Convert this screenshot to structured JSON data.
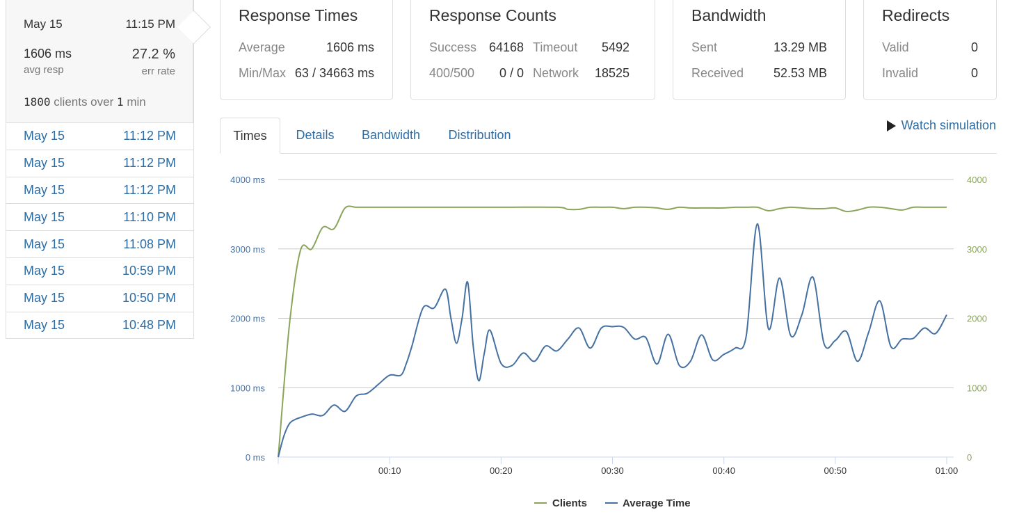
{
  "selected_run": {
    "date": "May 15",
    "time": "11:15 PM",
    "avg_resp": "1606 ms",
    "avg_resp_label": "avg resp",
    "err_rate": "27.2 %",
    "err_rate_label": "err rate",
    "clients_count": "1800",
    "clients_mid": "clients over",
    "duration_num": "1",
    "duration_unit": "min"
  },
  "runs": [
    {
      "date": "May 15",
      "time": "11:12 PM"
    },
    {
      "date": "May 15",
      "time": "11:12 PM"
    },
    {
      "date": "May 15",
      "time": "11:12 PM"
    },
    {
      "date": "May 15",
      "time": "11:10 PM"
    },
    {
      "date": "May 15",
      "time": "11:08 PM"
    },
    {
      "date": "May 15",
      "time": "10:59 PM"
    },
    {
      "date": "May 15",
      "time": "10:50 PM"
    },
    {
      "date": "May 15",
      "time": "10:48 PM"
    }
  ],
  "response_times": {
    "title": "Response Times",
    "average_label": "Average",
    "average": "1606 ms",
    "minmax_label": "Min/Max",
    "minmax": "63 / 34663 ms"
  },
  "response_counts": {
    "title": "Response Counts",
    "success_label": "Success",
    "success": "64168",
    "timeout_label": "Timeout",
    "timeout": "5492",
    "errors_label": "400/500",
    "errors": "0 / 0",
    "network_label": "Network",
    "network": "18525"
  },
  "bandwidth": {
    "title": "Bandwidth",
    "sent_label": "Sent",
    "sent": "13.29 MB",
    "received_label": "Received",
    "received": "52.53 MB"
  },
  "redirects": {
    "title": "Redirects",
    "valid_label": "Valid",
    "valid": "0",
    "invalid_label": "Invalid",
    "invalid": "0"
  },
  "tabs": [
    "Times",
    "Details",
    "Bandwidth",
    "Distribution"
  ],
  "active_tab": "Times",
  "watch_label": "Watch simulation",
  "colors": {
    "clients": "#8aa55a",
    "average_time": "#4570a2",
    "link": "#2e6da4"
  },
  "chart_data": {
    "type": "line",
    "x_ticks": [
      "00:10",
      "00:20",
      "00:30",
      "00:40",
      "00:50",
      "01:00"
    ],
    "y_left_ticks": [
      "0 ms",
      "1000 ms",
      "2000 ms",
      "3000 ms",
      "4000 ms"
    ],
    "y_right_ticks": [
      "0",
      "1000",
      "2000",
      "3000",
      "4000"
    ],
    "xlim": [
      0,
      60
    ],
    "ylim": [
      0,
      4000
    ],
    "grid": true,
    "legend_position": "bottom",
    "series": [
      {
        "name": "Clients",
        "axis": "right",
        "x": [
          0,
          1,
          2,
          3,
          4,
          5,
          6,
          7,
          8,
          10,
          15,
          20,
          25,
          26,
          27,
          28,
          29,
          30,
          31,
          32,
          33,
          34,
          35,
          36,
          37,
          38,
          39,
          40,
          41,
          42,
          43,
          44,
          45,
          46,
          47,
          48,
          49,
          50,
          51,
          52,
          53,
          54,
          55,
          56,
          57,
          58,
          59,
          60
        ],
        "values": [
          0,
          1900,
          2980,
          3000,
          3310,
          3290,
          3590,
          3600,
          3600,
          3600,
          3600,
          3600,
          3600,
          3570,
          3570,
          3600,
          3600,
          3600,
          3580,
          3600,
          3600,
          3590,
          3570,
          3600,
          3590,
          3590,
          3590,
          3590,
          3600,
          3600,
          3600,
          3550,
          3580,
          3600,
          3590,
          3580,
          3580,
          3590,
          3540,
          3560,
          3600,
          3600,
          3580,
          3560,
          3600,
          3600,
          3600,
          3600
        ]
      },
      {
        "name": "Average Time",
        "axis": "left",
        "x": [
          0,
          0.5,
          1,
          1.5,
          2,
          3,
          4,
          5,
          6,
          7,
          8,
          9,
          10,
          11,
          11.5,
          12,
          13,
          14,
          15,
          15.5,
          16,
          16.5,
          17,
          17.5,
          18,
          18.5,
          19,
          20,
          21,
          22,
          23,
          24,
          25,
          26,
          27,
          28,
          29,
          30,
          31,
          32,
          33,
          34,
          35,
          36,
          37,
          38,
          39,
          40,
          41,
          42,
          43,
          44,
          45,
          46,
          47,
          48,
          49,
          50,
          51,
          52,
          53,
          54,
          55,
          56,
          57,
          58,
          59,
          60
        ],
        "values": [
          0,
          300,
          480,
          540,
          570,
          620,
          600,
          750,
          660,
          880,
          920,
          1050,
          1180,
          1180,
          1350,
          1600,
          2150,
          2150,
          2420,
          2000,
          1640,
          2000,
          2520,
          1600,
          1100,
          1500,
          1830,
          1350,
          1320,
          1500,
          1380,
          1600,
          1530,
          1700,
          1860,
          1570,
          1860,
          1880,
          1870,
          1700,
          1720,
          1340,
          1770,
          1320,
          1380,
          1760,
          1400,
          1480,
          1570,
          1740,
          3360,
          1850,
          2580,
          1750,
          2050,
          2590,
          1630,
          1680,
          1810,
          1380,
          1800,
          2250,
          1590,
          1700,
          1710,
          1860,
          1780,
          2050
        ]
      }
    ]
  }
}
